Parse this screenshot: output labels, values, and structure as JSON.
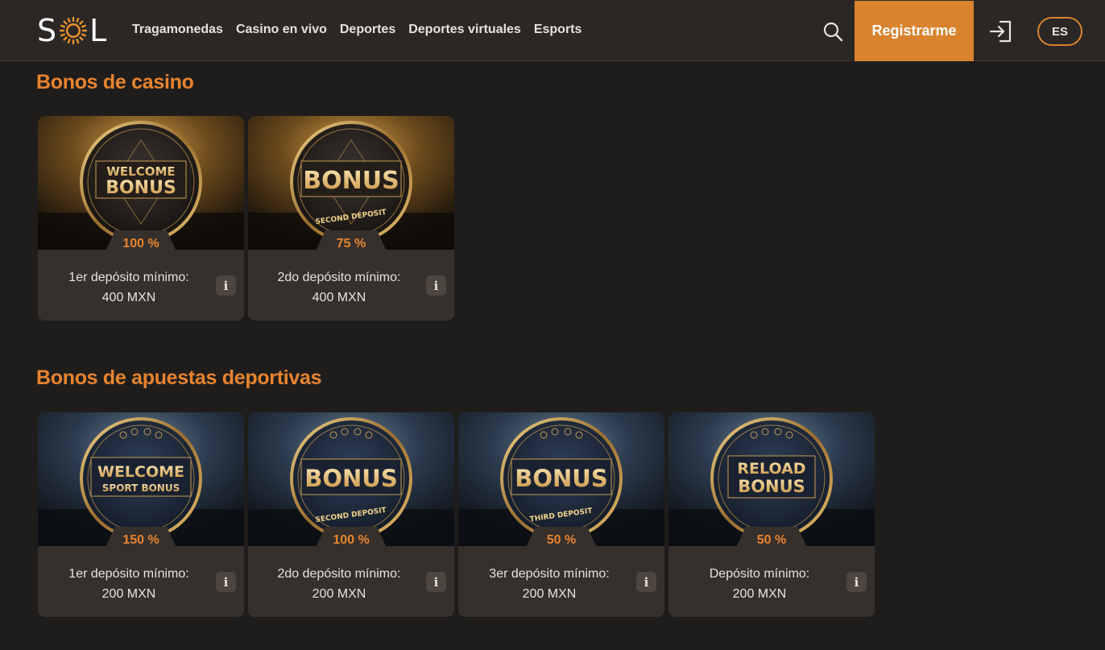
{
  "header": {
    "logo_left": "S",
    "logo_right": "L",
    "nav": [
      "Tragamonedas",
      "Casino en vivo",
      "Deportes",
      "Deportes virtuales",
      "Esports"
    ],
    "register_label": "Registrarme",
    "lang_label": "ES",
    "icons": {
      "search": "search-icon",
      "login": "login-icon"
    }
  },
  "casino": {
    "title": "Bonos de casino",
    "cards": [
      {
        "coin_line1": "WELCOME",
        "coin_line2": "BONUS",
        "coin_sub": "",
        "percent": "100 %",
        "desc_line1": "1er depósito mínimo:",
        "desc_line2": "400 MXN"
      },
      {
        "coin_line1": "",
        "coin_line2": "BONUS",
        "coin_sub": "SECOND DEPOSIT",
        "percent": "75 %",
        "desc_line1": "2do depósito mínimo:",
        "desc_line2": "400 MXN"
      }
    ]
  },
  "sports": {
    "title": "Bonos de apuestas deportivas",
    "cards": [
      {
        "coin_line1": "WELCOME",
        "coin_line2": "SPORT BONUS",
        "coin_sub": "",
        "percent": "150 %",
        "desc_line1": "1er depósito mínimo:",
        "desc_line2": "200 MXN"
      },
      {
        "coin_line1": "",
        "coin_line2": "BONUS",
        "coin_sub": "SECOND DEPOSIT",
        "percent": "100 %",
        "desc_line1": "2do depósito mínimo:",
        "desc_line2": "200 MXN"
      },
      {
        "coin_line1": "",
        "coin_line2": "BONUS",
        "coin_sub": "THIRD DEPOSIT",
        "percent": "50 %",
        "desc_line1": "3er depósito mínimo:",
        "desc_line2": "200 MXN"
      },
      {
        "coin_line1": "RELOAD",
        "coin_line2": "BONUS",
        "coin_sub": "",
        "percent": "50 %",
        "desc_line1": "Depósito mínimo:",
        "desc_line2": "200 MXN"
      }
    ]
  },
  "info_label": "i",
  "colors": {
    "accent": "#d9832f",
    "gold": "#e3b766",
    "bg": "#1f1d1c",
    "header": "#2b2725"
  }
}
